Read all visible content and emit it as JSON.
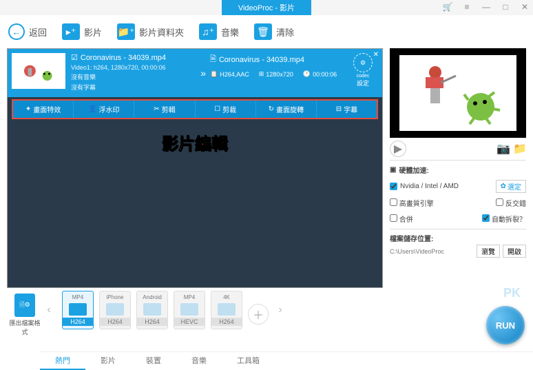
{
  "titlebar": {
    "title": "VideoProc - 影片"
  },
  "toolbar": {
    "back": "返回",
    "video": "影片",
    "folder": "影片資料夾",
    "music": "音樂",
    "clear": "清除"
  },
  "video_card": {
    "src_title": "Coronavirus - 34039.mp4",
    "src_info": "Video1: h264, 1280x720, 00:00:06",
    "no_audio": "沒有音樂",
    "no_sub": "沒有字幕",
    "dst_title": "Coronavirus - 34039.mp4",
    "dst_codec": "H264,AAC",
    "dst_res": "1280x720",
    "dst_dur": "00:00:06",
    "codec_label": "codec",
    "codec_setting": "設定"
  },
  "edit_bar": {
    "items": [
      "畫面特效",
      "浮水印",
      "剪輯",
      "剪裁",
      "畫面旋轉",
      "字幕"
    ]
  },
  "overlay": "影片編輯",
  "settings": {
    "hw_title": "硬體加速:",
    "hw_option": "Nvidia / Intel / AMD",
    "set_btn": "選定",
    "hq": "高畫質引擎",
    "deint": "反交錯",
    "merge": "合併",
    "autosplit": "自動拆裂？",
    "save_title": "檔案儲存位置:",
    "save_path": "C:\\Users\\VideoProc",
    "browse": "瀏覽",
    "open": "開啟"
  },
  "output_label": "匯出檔案格式",
  "formats": [
    {
      "head": "MP4",
      "foot": "H264",
      "active": true
    },
    {
      "head": "iPhone",
      "foot": "H264",
      "active": false
    },
    {
      "head": "Android",
      "foot": "H264",
      "active": false
    },
    {
      "head": "MP4",
      "foot": "HEVC",
      "active": false
    },
    {
      "head": "4K",
      "foot": "H264",
      "active": false
    }
  ],
  "categories": [
    "熱門",
    "影片",
    "裝置",
    "音樂",
    "工具箱"
  ],
  "run": "RUN",
  "watermark": "PK"
}
